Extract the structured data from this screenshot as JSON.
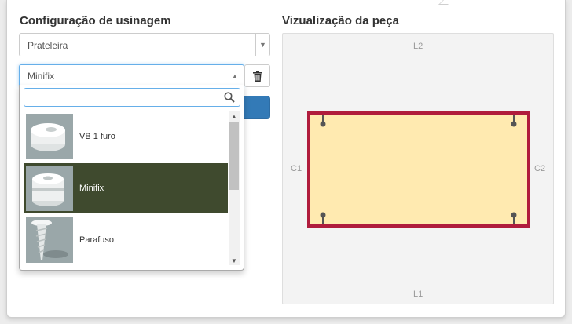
{
  "left_panel": {
    "title": "Configuração de usinagem",
    "piece_select": {
      "value": "Prateleira"
    },
    "machining_select": {
      "value": "Minifix"
    },
    "search": {
      "value": "",
      "placeholder": ""
    },
    "options": [
      {
        "label": "VB 1 furo",
        "icon": "cam-fitting-icon",
        "selected": false
      },
      {
        "label": "Minifix",
        "icon": "minifix-icon",
        "selected": true
      },
      {
        "label": "Parafuso",
        "icon": "screw-icon",
        "selected": false
      }
    ]
  },
  "right_panel": {
    "title": "Vizualização da peça",
    "edges": {
      "top": "L2",
      "bottom": "L1",
      "left": "C1",
      "right": "C2"
    },
    "colors": {
      "piece_fill": "#ffeab0",
      "piece_border": "#b01c3c",
      "hole": "#555555"
    }
  },
  "colors": {
    "accent": "#337ab7",
    "selected_option": "#3f4a2e"
  }
}
